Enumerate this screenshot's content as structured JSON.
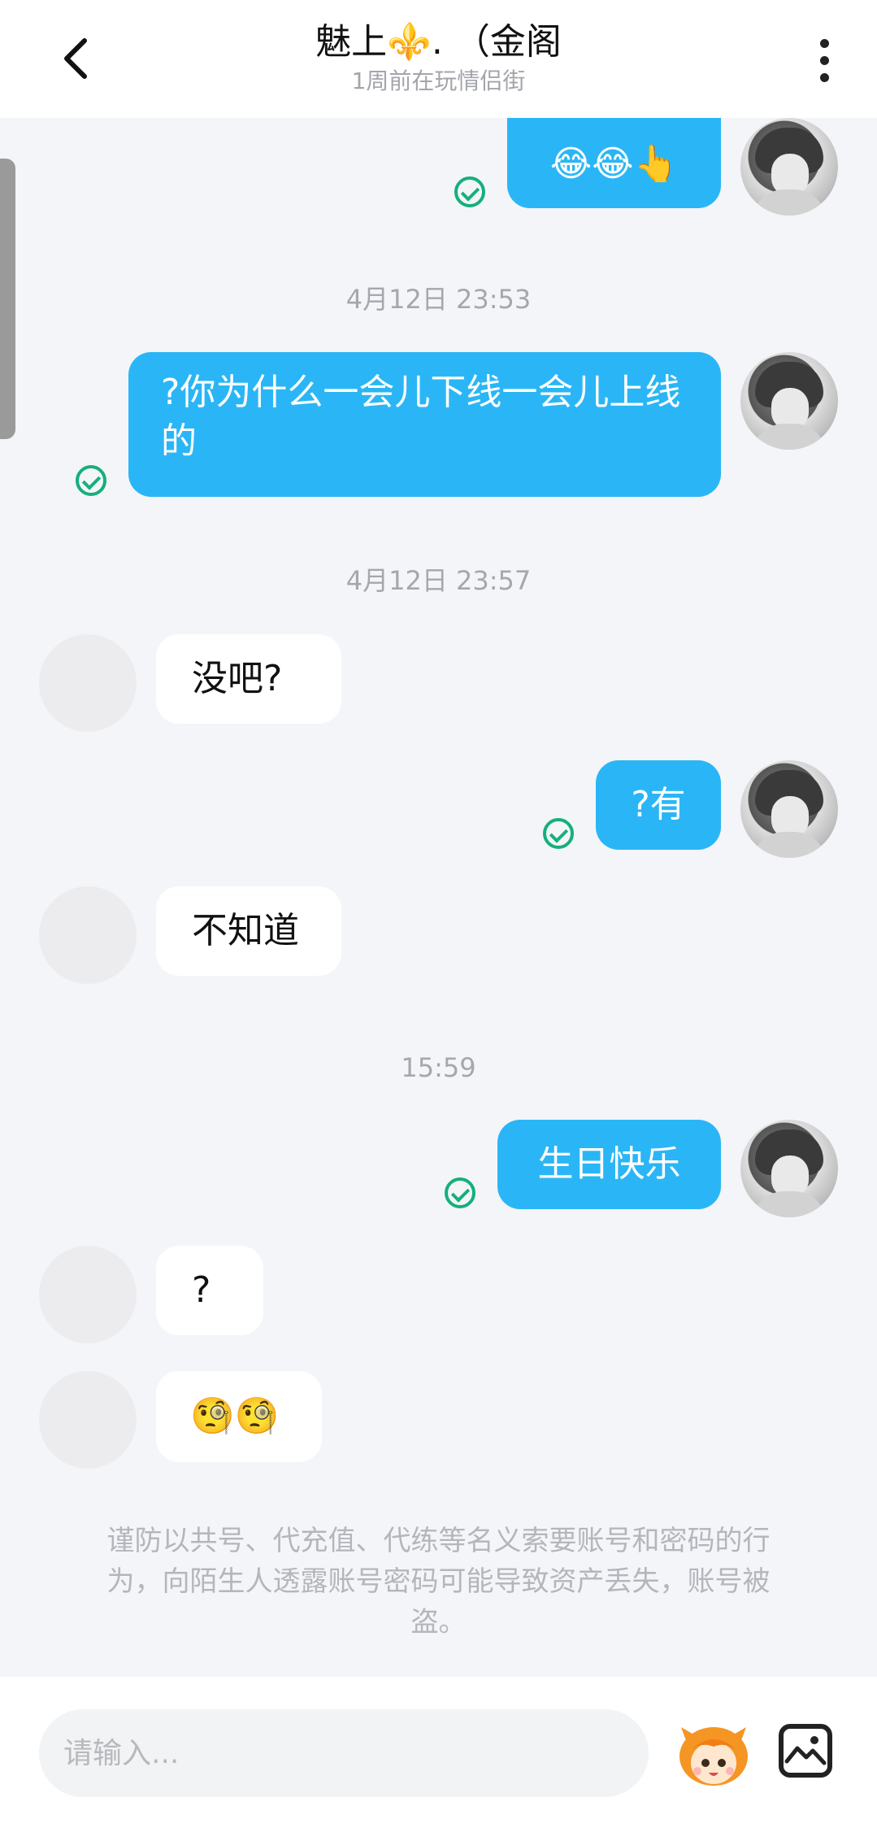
{
  "header": {
    "title": "魅上⚜️. （金阁",
    "subtitle": "1周前在玩情侣街"
  },
  "messages": [
    {
      "side": "me",
      "text": "😂😂👆"
    },
    {
      "timestamp": "4月12日 23:53"
    },
    {
      "side": "me",
      "text": "?你为什么一会儿下线一会儿上线的"
    },
    {
      "timestamp": "4月12日 23:57"
    },
    {
      "side": "peer",
      "text": "没吧?"
    },
    {
      "side": "me",
      "text": "?有"
    },
    {
      "side": "peer",
      "text": "不知道"
    },
    {
      "timestamp": "15:59"
    },
    {
      "side": "me",
      "text": "生日快乐"
    },
    {
      "side": "peer",
      "text": "?"
    },
    {
      "side": "peer",
      "text": "🧐🧐"
    }
  ],
  "notice": "谨防以共号、代充值、代练等名义索要账号和密码的行为，向陌生人透露账号密码可能导致资产丢失，账号被盗。",
  "input": {
    "placeholder": "请输入..."
  },
  "icons": {
    "back": "chevron-left-icon",
    "more": "more-vertical-icon",
    "read": "check-circle-icon",
    "mascot": "mascot-sticker-icon",
    "image": "image-icon"
  },
  "colors": {
    "my_bubble": "#2ab6f6",
    "peer_bubble": "#ffffff",
    "read_check": "#15b07a",
    "background": "#f4f5f9"
  }
}
